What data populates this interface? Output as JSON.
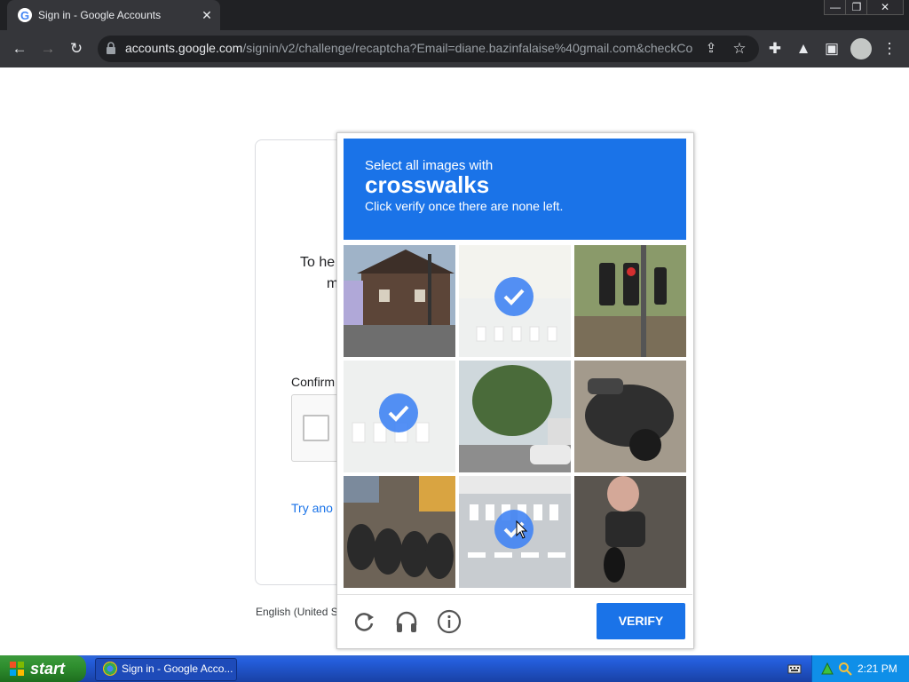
{
  "browser": {
    "tab_title": "Sign in - Google Accounts",
    "tab_close": "✕",
    "url_host": "accounts.google.com",
    "url_path": "/signin/v2/challenge/recaptcha?Email=diane.bazinfalaise%40gmail.com&checkCo...",
    "window_controls": [
      "—",
      "❐",
      "✕"
    ]
  },
  "signin": {
    "to_help_text": "To he",
    "to_help_text_2": "m",
    "confirm_label": "Confirm",
    "try_another": "Try ano",
    "language": "English (United S"
  },
  "captcha": {
    "instruction_line1": "Select all images with",
    "keyword": "crosswalks",
    "instruction_line3": "Click verify once there are none left.",
    "verify_label": "VERIFY",
    "tiles": [
      {
        "subject": "house-with-bus",
        "selected": false
      },
      {
        "subject": "crosswalk-faded",
        "selected": true
      },
      {
        "subject": "traffic-lights",
        "selected": false
      },
      {
        "subject": "crosswalk-faded",
        "selected": true
      },
      {
        "subject": "trees-and-car",
        "selected": false
      },
      {
        "subject": "scooter",
        "selected": false
      },
      {
        "subject": "parked-motorbikes",
        "selected": false
      },
      {
        "subject": "crosswalk-road",
        "selected": true
      },
      {
        "subject": "motorcycle-rider",
        "selected": false
      }
    ],
    "footer_icons": [
      "reload-icon",
      "audio-icon",
      "info-icon"
    ]
  },
  "taskbar": {
    "start_label": "start",
    "task_label": "Sign in - Google Acco...",
    "clock": "2:21 PM"
  },
  "colors": {
    "accent": "#1a73e8",
    "chrome_dark": "#202124",
    "taskbar_blue": "#245edc",
    "start_green": "#2f8f2f"
  }
}
